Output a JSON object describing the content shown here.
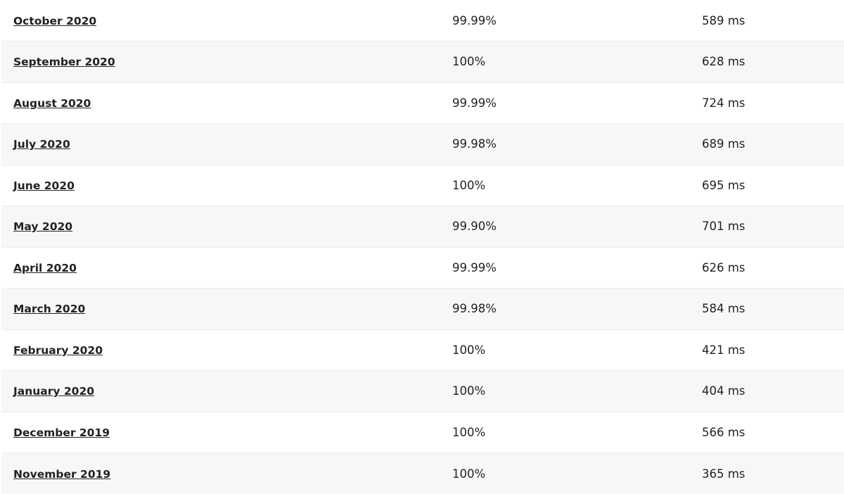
{
  "rows": [
    {
      "month": "October 2020",
      "uptime": "99.99%",
      "response": "589 ms"
    },
    {
      "month": "September 2020",
      "uptime": "100%",
      "response": "628 ms"
    },
    {
      "month": "August 2020",
      "uptime": "99.99%",
      "response": "724 ms"
    },
    {
      "month": "July 2020",
      "uptime": "99.98%",
      "response": "689 ms"
    },
    {
      "month": "June 2020",
      "uptime": "100%",
      "response": "695 ms"
    },
    {
      "month": "May 2020",
      "uptime": "99.90%",
      "response": "701 ms"
    },
    {
      "month": "April 2020",
      "uptime": "99.99%",
      "response": "626 ms"
    },
    {
      "month": "March 2020",
      "uptime": "99.98%",
      "response": "584 ms"
    },
    {
      "month": "February 2020",
      "uptime": "100%",
      "response": "421 ms"
    },
    {
      "month": "January 2020",
      "uptime": "100%",
      "response": "404 ms"
    },
    {
      "month": "December 2019",
      "uptime": "100%",
      "response": "566 ms"
    },
    {
      "month": "November 2019",
      "uptime": "100%",
      "response": "365 ms"
    }
  ]
}
